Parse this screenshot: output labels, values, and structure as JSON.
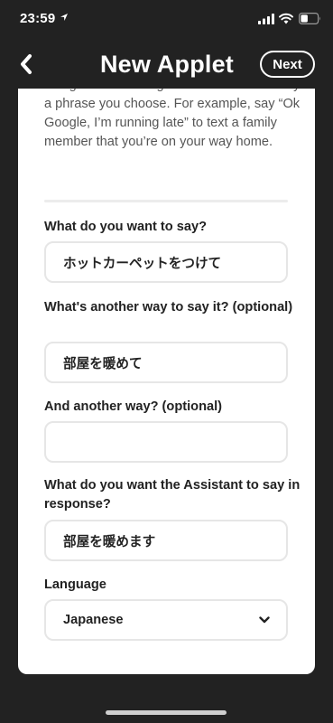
{
  "status_bar": {
    "time": "23:59"
  },
  "nav": {
    "title": "New Applet",
    "next_label": "Next"
  },
  "intro_text": "Google\" to the Google Assistant followed by a phrase you choose. For example, say “Ok Google, I’m running late” to text a family member that you’re on your way home.",
  "form": {
    "say_label": "What do you want to say?",
    "say_value": "ホットカーペットをつけて",
    "alt1_label": "What's another way to say it? (optional)",
    "alt1_value": "部屋を暖めて",
    "alt2_label": "And another way? (optional)",
    "alt2_value": "",
    "response_label": "What do you want the Assistant to say in response?",
    "response_value": "部屋を暖めます",
    "language_label": "Language",
    "language_value": "Japanese"
  }
}
